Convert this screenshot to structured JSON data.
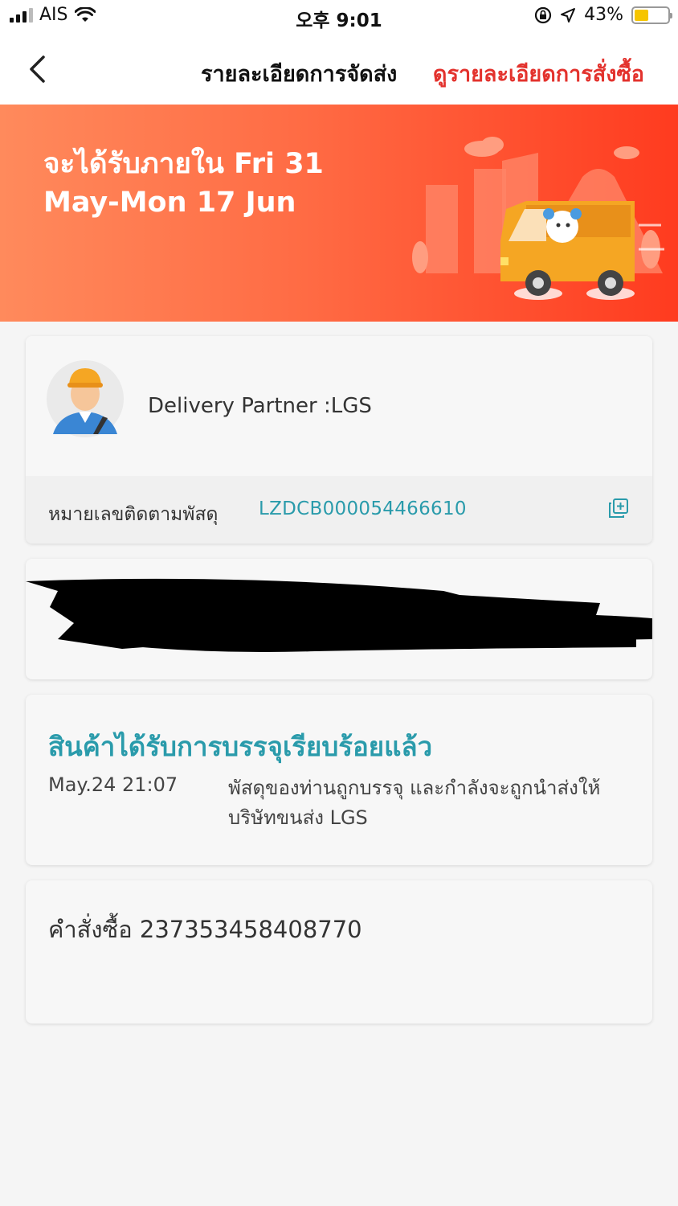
{
  "status_bar": {
    "carrier": "AIS",
    "time": "오후 9:01",
    "battery_percent": "43%",
    "battery_level": 0.43
  },
  "nav": {
    "title": "รายละเอียดการจัดส่ง",
    "order_details_link": "ดูรายละเอียดการสั่งซื้อ"
  },
  "banner": {
    "delivery_estimate": "จะได้รับภายใน Fri 31 May-Mon 17 Jun"
  },
  "partner": {
    "label": "Delivery Partner :LGS",
    "tracking_label": "หมายเลขติดตามพัสดุ",
    "tracking_number": "LZDCB000054466610"
  },
  "status": {
    "title": "สินค้าได้รับการบรรจุเรียบร้อยแล้ว",
    "time": "May.24 21:07",
    "description": "พัสดุของท่านถูกบรรจุ และกำลังจะถูกนำส่งให้บริษัทขนส่ง LGS"
  },
  "order": {
    "label": "คำสั่งซื้อ 237353458408770"
  },
  "colors": {
    "accent_red": "#e3322d",
    "teal": "#2a9bab",
    "banner_start": "#ff8a5c",
    "banner_end": "#ff3b1f"
  }
}
